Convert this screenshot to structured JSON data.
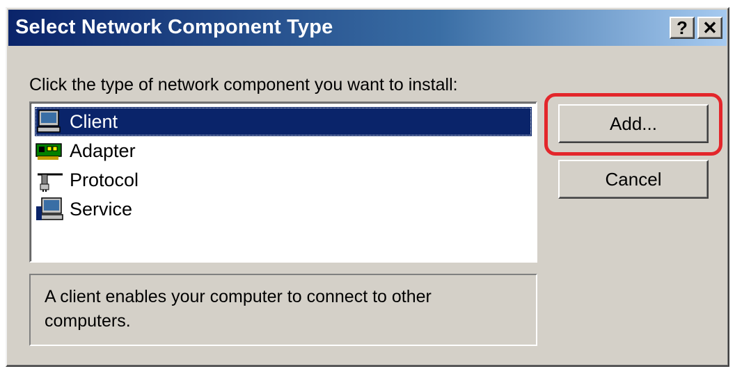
{
  "window": {
    "title": "Select Network Component Type",
    "help_button": "?",
    "close_button": "✕"
  },
  "prompt": "Click the type of network component you want to install:",
  "components": [
    {
      "label": "Client",
      "icon": "client-computer-icon",
      "selected": true
    },
    {
      "label": "Adapter",
      "icon": "network-adapter-icon",
      "selected": false
    },
    {
      "label": "Protocol",
      "icon": "protocol-plug-icon",
      "selected": false
    },
    {
      "label": "Service",
      "icon": "service-computer-icon",
      "selected": false
    }
  ],
  "buttons": {
    "add": "Add...",
    "cancel": "Cancel"
  },
  "description": "A client enables your computer to connect to other computers.",
  "colors": {
    "titlebar_start": "#0a246a",
    "titlebar_end": "#a6caf0",
    "selection": "#0a246a",
    "highlight_ring": "#e3262b",
    "dialog_face": "#d4d0c8"
  }
}
